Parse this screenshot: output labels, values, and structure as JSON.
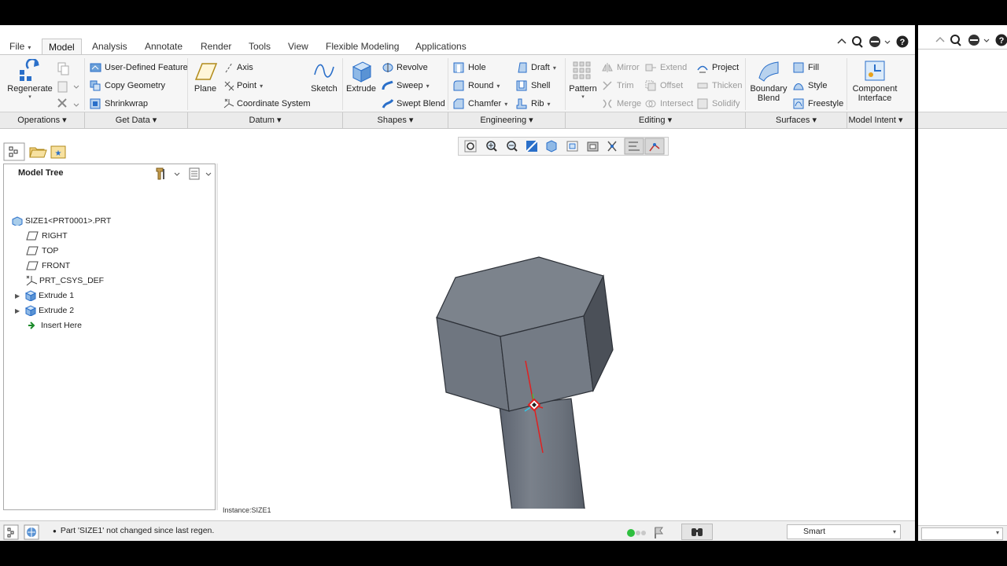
{
  "tabs": [
    {
      "label": "File"
    },
    {
      "label": "Model"
    },
    {
      "label": "Analysis"
    },
    {
      "label": "Annotate"
    },
    {
      "label": "Render"
    },
    {
      "label": "Tools"
    },
    {
      "label": "View"
    },
    {
      "label": "Flexible Modeling"
    },
    {
      "label": "Applications"
    }
  ],
  "file_caret": "▾",
  "ribbon": {
    "regenerate": "Regenerate",
    "user_defined_feature": "User-Defined Feature",
    "copy_geometry": "Copy Geometry",
    "shrinkwrap": "Shrinkwrap",
    "plane": "Plane",
    "axis": "Axis",
    "point": "Point",
    "coordinate_system": "Coordinate System",
    "sketch": "Sketch",
    "extrude": "Extrude",
    "revolve": "Revolve",
    "sweep": "Sweep",
    "swept_blend": "Swept Blend",
    "hole": "Hole",
    "round": "Round",
    "chamfer": "Chamfer",
    "draft": "Draft",
    "shell": "Shell",
    "rib": "Rib",
    "pattern": "Pattern",
    "mirror": "Mirror",
    "trim": "Trim",
    "merge": "Merge",
    "extend": "Extend",
    "offset": "Offset",
    "intersect": "Intersect",
    "project": "Project",
    "thicken": "Thicken",
    "solidify": "Solidify",
    "boundary_blend_1": "Boundary",
    "boundary_blend_2": "Blend",
    "fill": "Fill",
    "style": "Style",
    "freestyle": "Freestyle",
    "component_interface_1": "Component",
    "component_interface_2": "Interface"
  },
  "groups": [
    {
      "label": "Operations ▾"
    },
    {
      "label": "Get Data ▾"
    },
    {
      "label": "Datum ▾"
    },
    {
      "label": "Shapes ▾"
    },
    {
      "label": "Engineering ▾"
    },
    {
      "label": "Editing ▾"
    },
    {
      "label": "Surfaces ▾"
    },
    {
      "label": "Model Intent ▾"
    }
  ],
  "model_tree": {
    "title": "Model Tree",
    "items": [
      {
        "label": "SIZE1<PRT0001>.PRT"
      },
      {
        "label": "RIGHT"
      },
      {
        "label": "TOP"
      },
      {
        "label": "FRONT"
      },
      {
        "label": "PRT_CSYS_DEF"
      },
      {
        "label": "Extrude 1"
      },
      {
        "label": "Extrude 2"
      },
      {
        "label": "Insert Here"
      }
    ]
  },
  "viewport": {
    "instance_label": "Instance:SIZE1"
  },
  "status": {
    "message": "Part 'SIZE1' not changed since last regen.",
    "filter": "Smart"
  },
  "colors": {
    "accent": "#2a6fc9",
    "ribbon_bg": "#f6f6f6",
    "model_gray": "#767d86"
  }
}
